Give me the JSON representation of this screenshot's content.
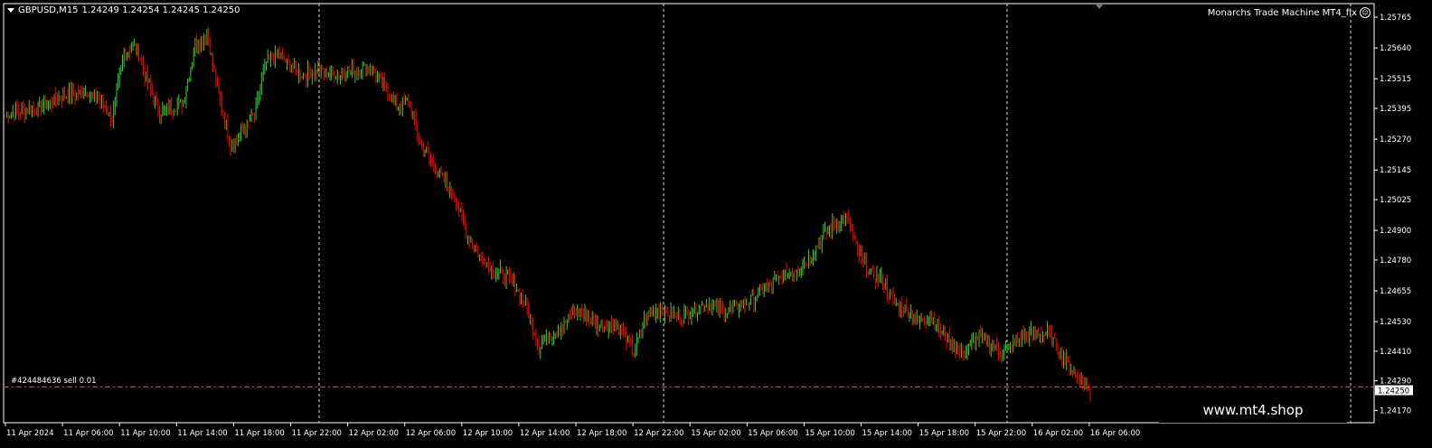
{
  "symbol_line": {
    "symbol": "GBPUSD,M15",
    "ohlc": "1.24249 1.24254 1.24245 1.24250"
  },
  "ea_label": "Monarchs Trade Machine MT4_fix",
  "order_label": "#424484636 sell 0.01",
  "watermark": "www.mt4.shop",
  "current_price": "1.24250",
  "colors": {
    "background": "#000000",
    "bull": "#32CD32",
    "bear": "#FF0000",
    "grid": "#FFFFFF",
    "order_line": "#CD5C5C"
  },
  "chart_data": {
    "type": "candlestick",
    "title": "",
    "y_ticks": [
      "1.25765",
      "1.25640",
      "1.25515",
      "1.25395",
      "1.25270",
      "1.25145",
      "1.25025",
      "1.24900",
      "1.24780",
      "1.24655",
      "1.24530",
      "1.24410",
      "1.24290",
      "1.24170"
    ],
    "x_ticks": [
      "11 Apr 2024",
      "11 Apr 06:00",
      "11 Apr 10:00",
      "11 Apr 14:00",
      "11 Apr 18:00",
      "11 Apr 22:00",
      "12 Apr 02:00",
      "12 Apr 06:00",
      "12 Apr 10:00",
      "12 Apr 14:00",
      "12 Apr 18:00",
      "12 Apr 22:00",
      "15 Apr 02:00",
      "15 Apr 06:00",
      "15 Apr 10:00",
      "15 Apr 14:00",
      "15 Apr 18:00",
      "15 Apr 22:00",
      "16 Apr 02:00",
      "16 Apr 06:00"
    ],
    "ylim": [
      1.2412,
      1.2582
    ],
    "order_price": 1.24265,
    "close_path": [
      [
        0,
        1.2537
      ],
      [
        6,
        1.254
      ],
      [
        10,
        1.2545
      ],
      [
        14,
        1.2546
      ],
      [
        16,
        1.2543
      ],
      [
        18,
        1.2535
      ],
      [
        20,
        1.2562
      ],
      [
        22,
        1.2565
      ],
      [
        24,
        1.255
      ],
      [
        26,
        1.2538
      ],
      [
        30,
        1.2542
      ],
      [
        32,
        1.2565
      ],
      [
        34,
        1.257
      ],
      [
        36,
        1.2545
      ],
      [
        38,
        1.2525
      ],
      [
        40,
        1.253
      ],
      [
        42,
        1.2537
      ],
      [
        44,
        1.2558
      ],
      [
        46,
        1.2561
      ],
      [
        50,
        1.2553
      ],
      [
        53,
        1.2555
      ],
      [
        56,
        1.2553
      ],
      [
        60,
        1.2556
      ],
      [
        62,
        1.2555
      ],
      [
        64,
        1.2548
      ],
      [
        66,
        1.254
      ],
      [
        68,
        1.2543
      ],
      [
        70,
        1.2525
      ],
      [
        72,
        1.2518
      ],
      [
        74,
        1.251
      ],
      [
        76,
        1.2502
      ],
      [
        78,
        1.2488
      ],
      [
        80,
        1.248
      ],
      [
        82,
        1.2475
      ],
      [
        84,
        1.2472
      ],
      [
        86,
        1.2468
      ],
      [
        88,
        1.2458
      ],
      [
        90,
        1.2443
      ],
      [
        92,
        1.2448
      ],
      [
        94,
        1.2451
      ],
      [
        96,
        1.2458
      ],
      [
        98,
        1.2455
      ],
      [
        100,
        1.2451
      ],
      [
        102,
        1.2452
      ],
      [
        104,
        1.245
      ],
      [
        106,
        1.244
      ],
      [
        108,
        1.2455
      ],
      [
        110,
        1.2458
      ],
      [
        114,
        1.2455
      ],
      [
        118,
        1.246
      ],
      [
        122,
        1.2457
      ],
      [
        126,
        1.2462
      ],
      [
        130,
        1.247
      ],
      [
        134,
        1.2475
      ],
      [
        136,
        1.248
      ],
      [
        138,
        1.2488
      ],
      [
        140,
        1.2493
      ],
      [
        142,
        1.2495
      ],
      [
        144,
        1.248
      ],
      [
        146,
        1.2472
      ],
      [
        148,
        1.247
      ],
      [
        150,
        1.246
      ],
      [
        152,
        1.2458
      ],
      [
        154,
        1.2453
      ],
      [
        156,
        1.2455
      ],
      [
        158,
        1.2448
      ],
      [
        160,
        1.2443
      ],
      [
        162,
        1.244
      ],
      [
        164,
        1.2447
      ],
      [
        166,
        1.2444
      ],
      [
        168,
        1.244
      ],
      [
        170,
        1.2443
      ],
      [
        172,
        1.2448
      ],
      [
        176,
        1.2448
      ],
      [
        178,
        1.244
      ],
      [
        180,
        1.2433
      ],
      [
        182,
        1.2428
      ],
      [
        183,
        1.2425
      ]
    ]
  }
}
